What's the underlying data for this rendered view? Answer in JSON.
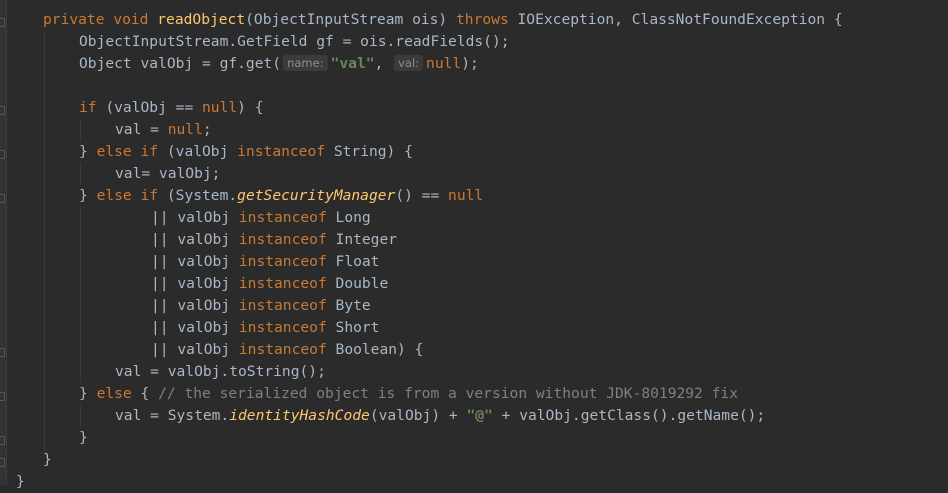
{
  "editor": {
    "lines": {
      "l1": {
        "kw_private": "private",
        "kw_void": "void",
        "method_name": "readObject",
        "params": "(ObjectInputStream ois) ",
        "kw_throws": "throws",
        "exceptions": " IOException, ClassNotFoundException {"
      },
      "l2": {
        "text": "ObjectInputStream.GetField gf = ois.readFields();"
      },
      "l3": {
        "prefix": "Object valObj = gf.get(",
        "hint_name": "name:",
        "arg_val": "\"val\"",
        "comma": ", ",
        "hint_val": "val:",
        "kw_null": "null",
        "suffix": ");"
      },
      "l5": {
        "kw_if": "if",
        "mid": " (valObj == ",
        "kw_null": "null",
        "suffix": ") {"
      },
      "l6": {
        "prefix": "val = ",
        "kw_null": "null",
        "suffix": ";"
      },
      "l7": {
        "prefix": "} ",
        "kw_else_if": "else if",
        "mid": " (valObj ",
        "kw_instanceof": "instanceof",
        "suffix": " String) {"
      },
      "l8": {
        "text": "val= valObj;"
      },
      "l9": {
        "prefix": "} ",
        "kw_else_if": "else if",
        "mid": " (System.",
        "method": "getSecurityManager",
        "mid2": "() == ",
        "kw_null": "null"
      },
      "instanceof_rows": [
        {
          "prefix": "|| valObj ",
          "kw": "instanceof",
          "type": " Long"
        },
        {
          "prefix": "|| valObj ",
          "kw": "instanceof",
          "type": " Integer"
        },
        {
          "prefix": "|| valObj ",
          "kw": "instanceof",
          "type": " Float"
        },
        {
          "prefix": "|| valObj ",
          "kw": "instanceof",
          "type": " Double"
        },
        {
          "prefix": "|| valObj ",
          "kw": "instanceof",
          "type": " Byte"
        },
        {
          "prefix": "|| valObj ",
          "kw": "instanceof",
          "type": " Short"
        },
        {
          "prefix": "|| valObj ",
          "kw": "instanceof",
          "type": " Boolean) {"
        }
      ],
      "l17": {
        "text": "val = valObj.toString();"
      },
      "l18": {
        "prefix": "} ",
        "kw_else": "else",
        "mid": " { ",
        "comment": "// the serialized object is from a version without JDK-8019292 fix"
      },
      "l19": {
        "prefix": "val = System.",
        "method": "identityHashCode",
        "mid": "(valObj) + ",
        "str_at": "\"@\"",
        "suffix": " + valObj.getClass().getName();"
      },
      "l20": {
        "text": "}"
      },
      "l21": {
        "text": "}"
      },
      "l22": {
        "text": "}"
      }
    }
  }
}
